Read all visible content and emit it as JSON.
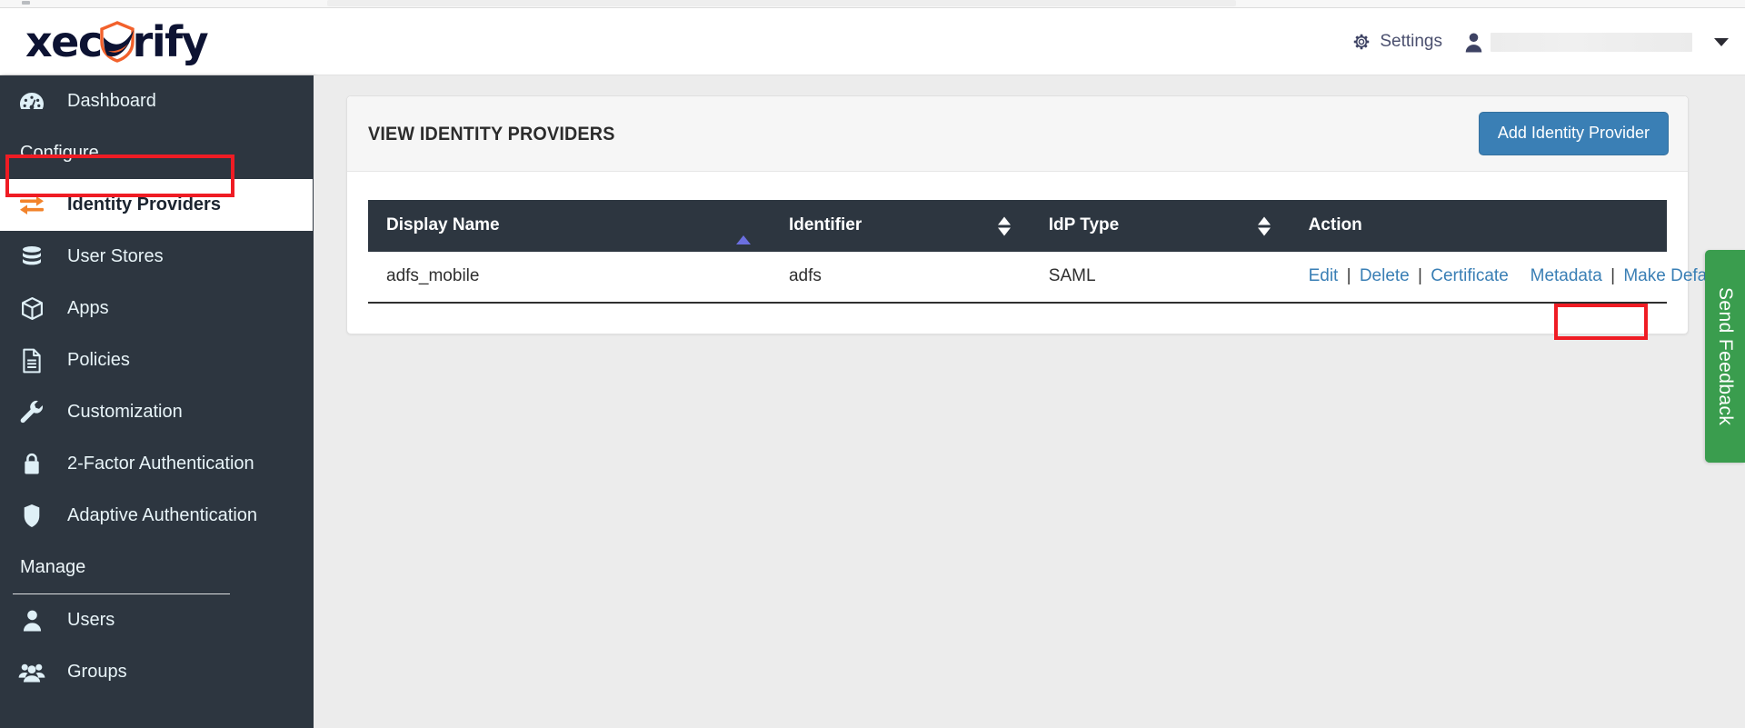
{
  "browser": {
    "address_redacted": true
  },
  "brand": {
    "logo_part1": "xec",
    "logo_part2": "rify",
    "logo_icon": "shield-icon"
  },
  "header": {
    "settings_label": "Settings",
    "settings_icon": "gear-icon",
    "user_icon": "person-icon",
    "user_name_redacted": "",
    "dropdown_icon": "chevron-down-icon"
  },
  "sidebar": {
    "items": [
      {
        "label": "Dashboard",
        "icon": "gauge-icon",
        "type": "item",
        "active": false
      },
      {
        "label": "Configure",
        "type": "section"
      },
      {
        "label": "Identity Providers",
        "icon": "exchange-arrows-icon",
        "type": "item",
        "active": true
      },
      {
        "label": "User Stores",
        "icon": "database-icon",
        "type": "item",
        "active": false
      },
      {
        "label": "Apps",
        "icon": "cube-icon",
        "type": "item",
        "active": false
      },
      {
        "label": "Policies",
        "icon": "document-icon",
        "type": "item",
        "active": false
      },
      {
        "label": "Customization",
        "icon": "wrench-icon",
        "type": "item",
        "active": false
      },
      {
        "label": "2-Factor Authentication",
        "icon": "lock-icon",
        "type": "item",
        "active": false
      },
      {
        "label": "Adaptive Authentication",
        "icon": "shield-icon",
        "type": "item",
        "active": false
      },
      {
        "label": "Manage",
        "type": "section"
      },
      {
        "label": "Users",
        "icon": "user-icon",
        "type": "item",
        "active": false
      },
      {
        "label": "Groups",
        "icon": "group-icon",
        "type": "item",
        "active": false
      }
    ]
  },
  "main": {
    "card_title": "VIEW IDENTITY PROVIDERS",
    "add_button_label": "Add Identity Provider",
    "table": {
      "columns": [
        {
          "label": "Display Name",
          "sort": "asc-active"
        },
        {
          "label": "Identifier",
          "sort": "both"
        },
        {
          "label": "IdP Type",
          "sort": "both"
        },
        {
          "label": "Action",
          "sort": "none"
        }
      ],
      "rows": [
        {
          "display_name": "adfs_mobile",
          "identifier": "adfs",
          "idp_type": "SAML",
          "actions": [
            "Edit",
            "Delete",
            "Certificate",
            "Metadata",
            "Make Default"
          ],
          "separator": "|"
        }
      ]
    }
  },
  "feedback": {
    "label": "Send Feedback"
  },
  "colors": {
    "sidebar_bg": "#2d3640",
    "page_bg": "#ececec",
    "accent_blue": "#3a7fb5",
    "link_blue": "#3a7fb5",
    "highlight_red": "#ef1c24",
    "feedback_green": "#3a9d4e",
    "logo_navy": "#0d1333",
    "logo_orange": "#f2612c",
    "sort_active": "#6b6fe0"
  },
  "highlights": [
    {
      "target": "sidebar-item-identity-providers",
      "color": "#ef1c24"
    },
    {
      "target": "action-link-certificate",
      "color": "#ef1c24"
    }
  ]
}
